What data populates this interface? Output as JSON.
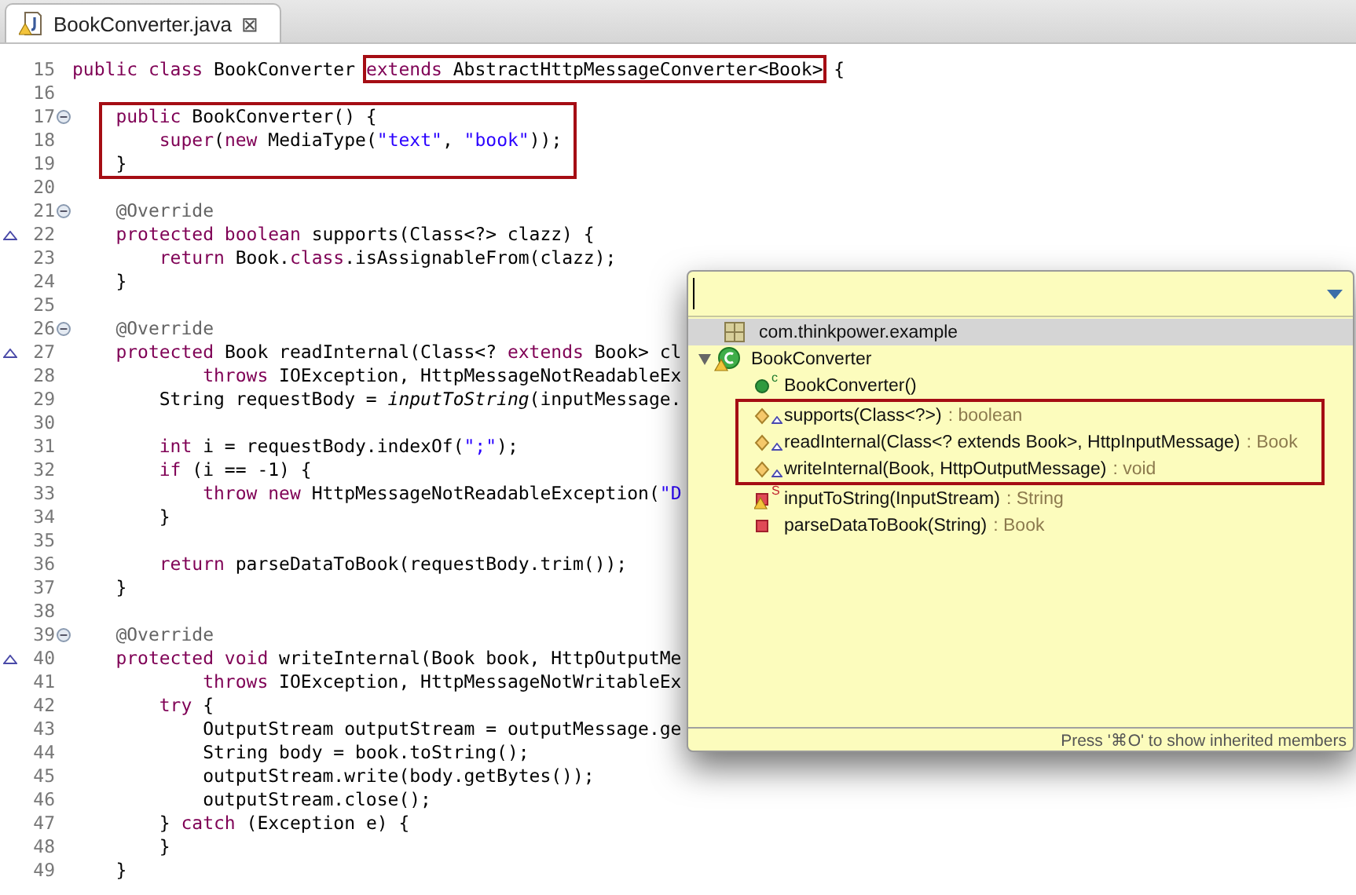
{
  "editor_tab": {
    "title": "BookConverter.java",
    "warning": true,
    "close": "⊠",
    "selected": true
  },
  "code_lines": [
    {
      "number": "15",
      "tokens": [
        {
          "text": "public class ",
          "kind": "keyword"
        },
        {
          "text": "BookConverter ",
          "kind": "plain"
        },
        {
          "text": "extends ",
          "kind": "keyword",
          "boxed": true
        },
        {
          "text": "AbstractHttpMessageConverter<Book>",
          "kind": "plain",
          "boxed": true
        },
        {
          "text": " {",
          "kind": "plain"
        }
      ]
    },
    {
      "number": "16"
    },
    {
      "number": "17",
      "foldable": true,
      "boxed": true,
      "tokens": [
        {
          "text": "    public ",
          "kind": "keyword"
        },
        {
          "text": "BookConverter() {",
          "kind": "plain"
        }
      ]
    },
    {
      "number": "18",
      "boxed": true,
      "tokens": [
        {
          "text": "        super",
          "kind": "keyword"
        },
        {
          "text": "(",
          "kind": "plain"
        },
        {
          "text": "new ",
          "kind": "keyword"
        },
        {
          "text": "MediaType(",
          "kind": "plain"
        },
        {
          "text": "\"text\"",
          "kind": "string"
        },
        {
          "text": ", ",
          "kind": "plain"
        },
        {
          "text": "\"book\"",
          "kind": "string"
        },
        {
          "text": "));",
          "kind": "plain"
        }
      ]
    },
    {
      "number": "19",
      "boxed": true,
      "tokens": [
        {
          "text": "    }",
          "kind": "plain"
        }
      ]
    },
    {
      "number": "20"
    },
    {
      "number": "21",
      "foldable": true,
      "tokens": [
        {
          "text": "    @Override",
          "kind": "annotation"
        }
      ]
    },
    {
      "number": "22",
      "overrides": true,
      "tokens": [
        {
          "text": "    protected boolean ",
          "kind": "keyword"
        },
        {
          "text": "supports(Class<?> clazz) {",
          "kind": "plain"
        }
      ]
    },
    {
      "number": "23",
      "tokens": [
        {
          "text": "        return ",
          "kind": "keyword"
        },
        {
          "text": "Book.",
          "kind": "plain"
        },
        {
          "text": "class",
          "kind": "keyword"
        },
        {
          "text": ".isAssignableFrom(clazz);",
          "kind": "plain"
        }
      ]
    },
    {
      "number": "24",
      "tokens": [
        {
          "text": "    }",
          "kind": "plain"
        }
      ]
    },
    {
      "number": "25"
    },
    {
      "number": "26",
      "foldable": true,
      "tokens": [
        {
          "text": "    @Override",
          "kind": "annotation"
        }
      ]
    },
    {
      "number": "27",
      "overrides": true,
      "tokens": [
        {
          "text": "    protected ",
          "kind": "keyword"
        },
        {
          "text": "Book readInternal(Class<? ",
          "kind": "plain"
        },
        {
          "text": "extends ",
          "kind": "keyword"
        },
        {
          "text": "Book> cl",
          "kind": "plain"
        }
      ]
    },
    {
      "number": "28",
      "tokens": [
        {
          "text": "            throws ",
          "kind": "keyword"
        },
        {
          "text": "IOException, HttpMessageNotReadableEx",
          "kind": "plain"
        }
      ]
    },
    {
      "number": "29",
      "tokens": [
        {
          "text": "        String requestBody = ",
          "kind": "plain"
        },
        {
          "text": "inputToString",
          "kind": "italic"
        },
        {
          "text": "(inputMessage.",
          "kind": "plain"
        }
      ]
    },
    {
      "number": "30"
    },
    {
      "number": "31",
      "tokens": [
        {
          "text": "        int ",
          "kind": "keyword"
        },
        {
          "text": "i = requestBody.indexOf(",
          "kind": "plain"
        },
        {
          "text": "\";\"",
          "kind": "string"
        },
        {
          "text": ");",
          "kind": "plain"
        }
      ]
    },
    {
      "number": "32",
      "tokens": [
        {
          "text": "        if ",
          "kind": "keyword"
        },
        {
          "text": "(i == -1) {",
          "kind": "plain"
        }
      ]
    },
    {
      "number": "33",
      "tokens": [
        {
          "text": "            throw new ",
          "kind": "keyword"
        },
        {
          "text": "HttpMessageNotReadableException(",
          "kind": "plain"
        },
        {
          "text": "\"D",
          "kind": "string"
        }
      ]
    },
    {
      "number": "34",
      "tokens": [
        {
          "text": "        }",
          "kind": "plain"
        }
      ]
    },
    {
      "number": "35"
    },
    {
      "number": "36",
      "tokens": [
        {
          "text": "        return ",
          "kind": "keyword"
        },
        {
          "text": "parseDataToBook(requestBody.trim());",
          "kind": "plain"
        }
      ]
    },
    {
      "number": "37",
      "tokens": [
        {
          "text": "    }",
          "kind": "plain"
        }
      ]
    },
    {
      "number": "38"
    },
    {
      "number": "39",
      "foldable": true,
      "tokens": [
        {
          "text": "    @Override",
          "kind": "annotation"
        }
      ]
    },
    {
      "number": "40",
      "overrides": true,
      "tokens": [
        {
          "text": "    protected void ",
          "kind": "keyword"
        },
        {
          "text": "writeInternal(Book book, HttpOutputMe",
          "kind": "plain"
        }
      ]
    },
    {
      "number": "41",
      "tokens": [
        {
          "text": "            throws ",
          "kind": "keyword"
        },
        {
          "text": "IOException, HttpMessageNotWritableEx",
          "kind": "plain"
        }
      ]
    },
    {
      "number": "42",
      "tokens": [
        {
          "text": "        try ",
          "kind": "keyword"
        },
        {
          "text": "{",
          "kind": "plain"
        }
      ]
    },
    {
      "number": "43",
      "tokens": [
        {
          "text": "            OutputStream outputStream = outputMessage.ge",
          "kind": "plain"
        }
      ]
    },
    {
      "number": "44",
      "tokens": [
        {
          "text": "            String body = book.toString();",
          "kind": "plain"
        }
      ]
    },
    {
      "number": "45",
      "tokens": [
        {
          "text": "            outputStream.write(body.getBytes());",
          "kind": "plain"
        }
      ]
    },
    {
      "number": "46",
      "tokens": [
        {
          "text": "            outputStream.close();",
          "kind": "plain"
        }
      ]
    },
    {
      "number": "47",
      "tokens": [
        {
          "text": "        } ",
          "kind": "plain"
        },
        {
          "text": "catch ",
          "kind": "keyword"
        },
        {
          "text": "(Exception e) {",
          "kind": "plain"
        }
      ]
    },
    {
      "number": "48",
      "tokens": [
        {
          "text": "        }",
          "kind": "plain"
        }
      ]
    },
    {
      "number": "49",
      "tokens": [
        {
          "text": "    }",
          "kind": "plain"
        }
      ]
    }
  ],
  "quick_outline": {
    "items": [
      {
        "kind": "package",
        "label": "com.thinkpower.example",
        "selected": true
      },
      {
        "kind": "class",
        "label": "BookConverter",
        "selected": false,
        "expanded": true,
        "warning": true,
        "children": [
          {
            "kind": "constructor",
            "badge": "c",
            "label": "BookConverter()",
            "selected": false
          },
          {
            "kind": "protected",
            "label": "supports(Class<?>)",
            "return_type": ": boolean",
            "selected": false,
            "overrides": true,
            "highlighted": true
          },
          {
            "kind": "protected",
            "label": "readInternal(Class<? extends Book>, HttpInputMessage)",
            "return_type": ": Book",
            "selected": false,
            "overrides": true,
            "highlighted": true
          },
          {
            "kind": "protected",
            "label": "writeInternal(Book, HttpOutputMessage)",
            "return_type": ": void",
            "selected": false,
            "overrides": true,
            "highlighted": true
          },
          {
            "kind": "private",
            "badge": "S",
            "label": "inputToString(InputStream)",
            "return_type": ": String",
            "selected": false,
            "warning": true
          },
          {
            "kind": "private",
            "label": "parseDataToBook(String)",
            "return_type": ": Book",
            "selected": false
          }
        ]
      }
    ],
    "hint": "Press '⌘O' to show inherited members"
  }
}
